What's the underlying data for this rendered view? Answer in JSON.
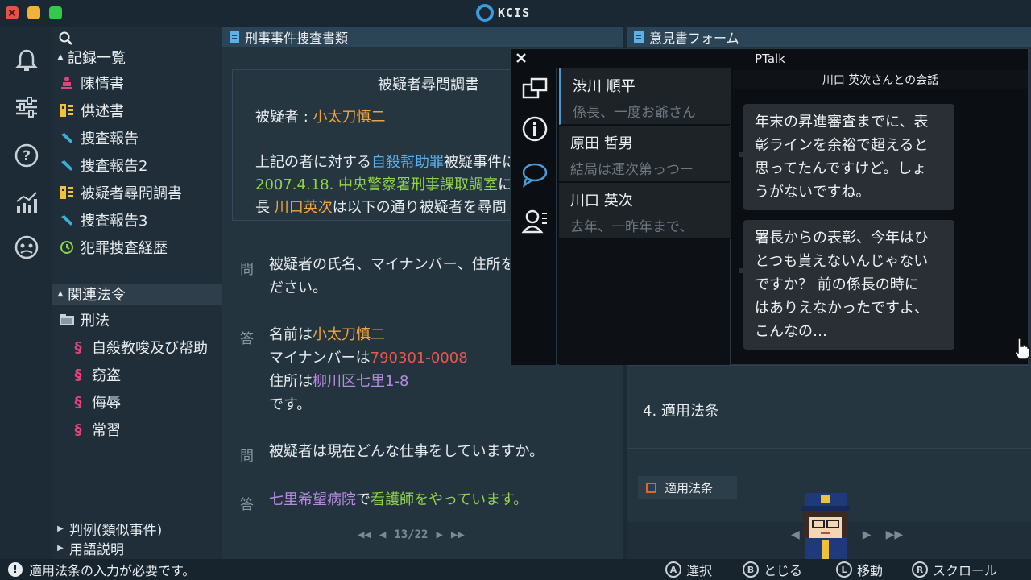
{
  "app": {
    "name": "KCIS"
  },
  "sidebar": {
    "records_header": "記録一覧",
    "records": [
      {
        "label": "陳情書",
        "icon": "person-icon",
        "color": "#e0457a"
      },
      {
        "label": "供述書",
        "icon": "statement-icon",
        "color": "#f0c23a"
      },
      {
        "label": "捜査報告",
        "icon": "pencil-icon",
        "color": "#3ab0d8"
      },
      {
        "label": "捜査報告2",
        "icon": "pencil-icon",
        "color": "#3ab0d8"
      },
      {
        "label": "被疑者尋問調書",
        "icon": "statement-icon",
        "color": "#f0c23a"
      },
      {
        "label": "捜査報告3",
        "icon": "pencil-icon",
        "color": "#3ab0d8"
      },
      {
        "label": "犯罪捜査経歴",
        "icon": "history-icon",
        "color": "#8fd44a"
      }
    ],
    "laws_header": "関連法令",
    "law_folder": "刑法",
    "laws": [
      "自殺教唆及び帮助",
      "窃盗",
      "侮辱",
      "常習"
    ],
    "collapsed": [
      "判例(類似事件)",
      "用語説明"
    ]
  },
  "left_panel": {
    "title": "刑事事件捜査書類",
    "doc_title": "被疑者尋問調書",
    "suspect_label": "被疑者 : ",
    "suspect_name": "小太刀慎二",
    "para_1a": "上記の者に対する",
    "para_1b": "自殺幇助罪",
    "para_1c": "被疑事件に対",
    "para_2a": "2007.4.18. 中央警察署刑事課取調室",
    "para_2b": "に",
    "para_3a": "長 ",
    "para_3b": "川口英次",
    "para_3c": "は以下の通り被疑者を尋問した",
    "qa": [
      {
        "tag": "問",
        "line1": "被疑者の氏名、マイナンバー、住所を述べてく",
        "line2": "ださい。"
      },
      {
        "tag": "答",
        "a_prefix": "名前は",
        "a_name": "小太刀慎二",
        "b_prefix": "マイナンバーは",
        "b_number": "790301-0008",
        "c_prefix": "住所は",
        "c_addr": "柳川区七里1-8",
        "d": "です。"
      },
      {
        "tag": "問",
        "line1": "被疑者は現在どんな仕事をしていますか。"
      },
      {
        "tag": "答",
        "a_place": "七里希望病院",
        "a_mid": "で",
        "a_job": "看護師をやっています。"
      }
    ],
    "pager": "13/22"
  },
  "right_panel": {
    "title": "意見書フォーム",
    "section_label": "4. 適用法条",
    "chip_label": "適用法条"
  },
  "ptalk": {
    "title": "PTalk",
    "conversation_title": "川口 英次さんとの会話",
    "contacts": [
      {
        "name": "渋川 順平",
        "preview": "係長、一度お爺さん"
      },
      {
        "name": "原田 哲男",
        "preview": "結局は運次第っつー"
      },
      {
        "name": "川口 英次",
        "preview": "去年、一昨年まで、"
      }
    ],
    "messages": [
      {
        "lines": [
          "年末の昇進審査までに、表",
          "彰ラインを余裕で超えると",
          "思ってたんですけど。しょ",
          "うがないですね。"
        ]
      },
      {
        "lines": [
          "署長からの表彰、今年はひ",
          "とつも貰えないんじゃない",
          "ですか？ 前の係長の時に",
          "はありえなかったですよ、",
          "こんなの…"
        ]
      }
    ]
  },
  "status": {
    "message": "適用法条の入力が必要です。",
    "hints": [
      {
        "key": "A",
        "label": "選択"
      },
      {
        "key": "B",
        "label": "とじる"
      },
      {
        "key": "L",
        "label": "移動"
      },
      {
        "key": "R",
        "label": "スクロール"
      }
    ]
  }
}
